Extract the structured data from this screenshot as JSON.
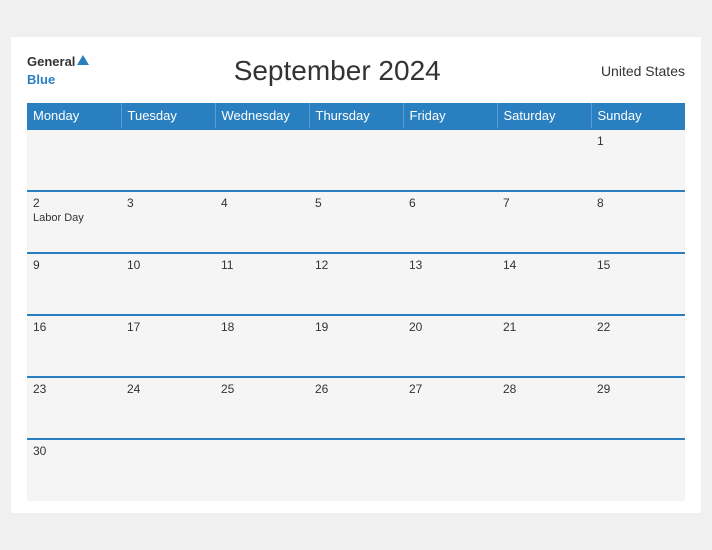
{
  "header": {
    "logo_general": "General",
    "logo_blue": "Blue",
    "title": "September 2024",
    "country": "United States"
  },
  "weekdays": [
    "Monday",
    "Tuesday",
    "Wednesday",
    "Thursday",
    "Friday",
    "Saturday",
    "Sunday"
  ],
  "weeks": [
    [
      {
        "day": "",
        "event": ""
      },
      {
        "day": "",
        "event": ""
      },
      {
        "day": "",
        "event": ""
      },
      {
        "day": "",
        "event": ""
      },
      {
        "day": "",
        "event": ""
      },
      {
        "day": "",
        "event": ""
      },
      {
        "day": "1",
        "event": ""
      }
    ],
    [
      {
        "day": "2",
        "event": "Labor Day"
      },
      {
        "day": "3",
        "event": ""
      },
      {
        "day": "4",
        "event": ""
      },
      {
        "day": "5",
        "event": ""
      },
      {
        "day": "6",
        "event": ""
      },
      {
        "day": "7",
        "event": ""
      },
      {
        "day": "8",
        "event": ""
      }
    ],
    [
      {
        "day": "9",
        "event": ""
      },
      {
        "day": "10",
        "event": ""
      },
      {
        "day": "11",
        "event": ""
      },
      {
        "day": "12",
        "event": ""
      },
      {
        "day": "13",
        "event": ""
      },
      {
        "day": "14",
        "event": ""
      },
      {
        "day": "15",
        "event": ""
      }
    ],
    [
      {
        "day": "16",
        "event": ""
      },
      {
        "day": "17",
        "event": ""
      },
      {
        "day": "18",
        "event": ""
      },
      {
        "day": "19",
        "event": ""
      },
      {
        "day": "20",
        "event": ""
      },
      {
        "day": "21",
        "event": ""
      },
      {
        "day": "22",
        "event": ""
      }
    ],
    [
      {
        "day": "23",
        "event": ""
      },
      {
        "day": "24",
        "event": ""
      },
      {
        "day": "25",
        "event": ""
      },
      {
        "day": "26",
        "event": ""
      },
      {
        "day": "27",
        "event": ""
      },
      {
        "day": "28",
        "event": ""
      },
      {
        "day": "29",
        "event": ""
      }
    ],
    [
      {
        "day": "30",
        "event": ""
      },
      {
        "day": "",
        "event": ""
      },
      {
        "day": "",
        "event": ""
      },
      {
        "day": "",
        "event": ""
      },
      {
        "day": "",
        "event": ""
      },
      {
        "day": "",
        "event": ""
      },
      {
        "day": "",
        "event": ""
      }
    ]
  ]
}
